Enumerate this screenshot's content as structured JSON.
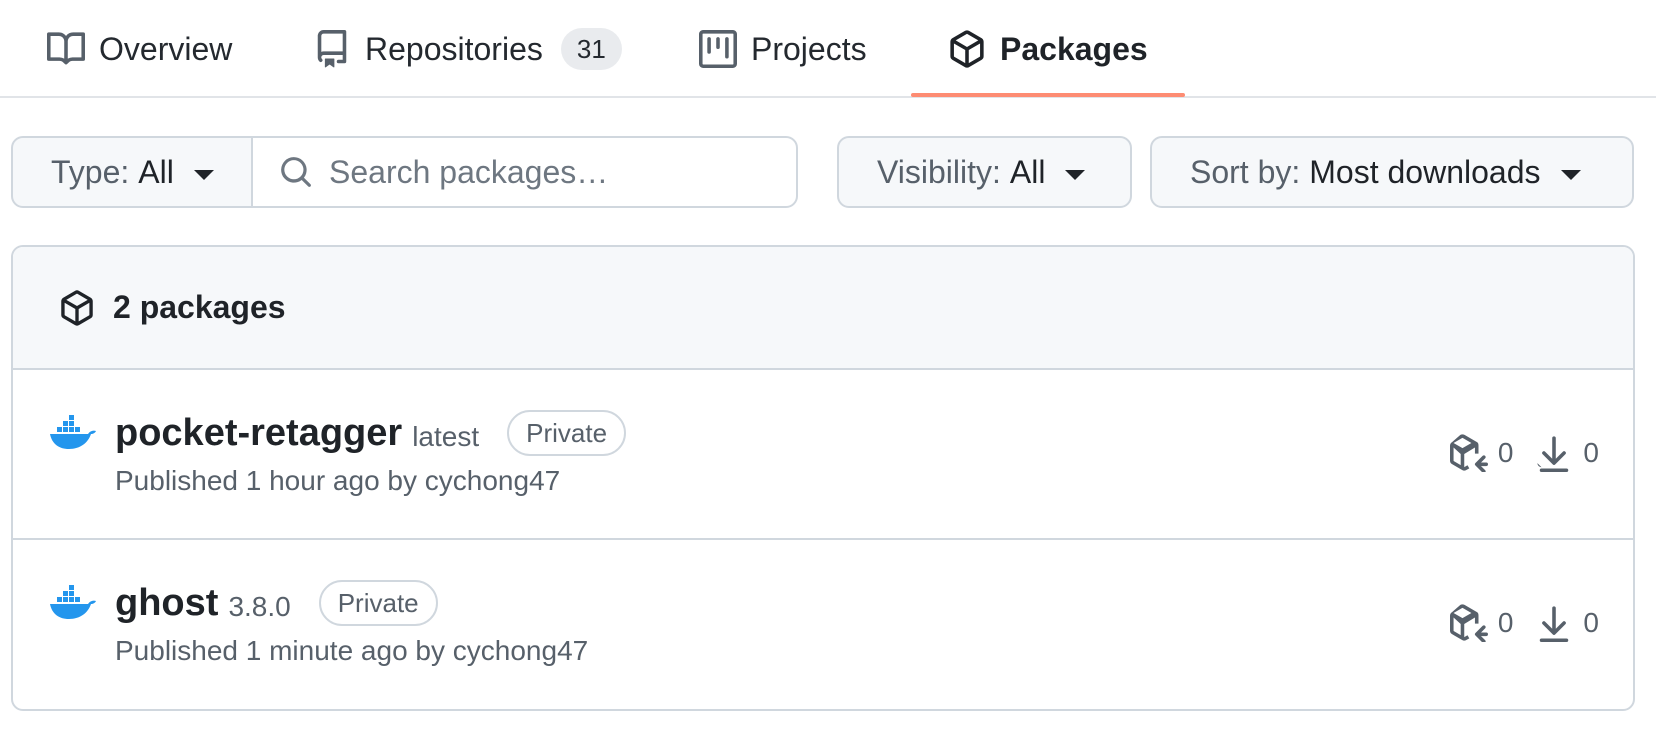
{
  "tabs": [
    {
      "label": "Overview",
      "icon": "book-icon"
    },
    {
      "label": "Repositories",
      "icon": "repo-icon",
      "count": "31"
    },
    {
      "label": "Projects",
      "icon": "project-icon"
    },
    {
      "label": "Packages",
      "icon": "package-icon",
      "selected": true
    }
  ],
  "filters": {
    "type_label": "Type:",
    "type_value": "All",
    "search_placeholder": "Search packages…",
    "visibility_label": "Visibility:",
    "visibility_value": "All",
    "sort_label": "Sort by:",
    "sort_value": "Most downloads"
  },
  "list": {
    "header": "2 packages",
    "packages": [
      {
        "name": "pocket-retagger",
        "tag": "latest",
        "visibility": "Private",
        "published": "Published 1 hour ago by cychong47",
        "versions": "0",
        "downloads": "0",
        "icon": "docker-icon"
      },
      {
        "name": "ghost",
        "tag": "3.8.0",
        "visibility": "Private",
        "published": "Published 1 minute ago by cychong47",
        "versions": "0",
        "downloads": "0",
        "icon": "docker-icon"
      }
    ]
  },
  "colors": {
    "accent_underline": "#fd8c73",
    "docker_blue": "#2496ed",
    "border": "#d0d7de",
    "muted_text": "#57606a"
  }
}
